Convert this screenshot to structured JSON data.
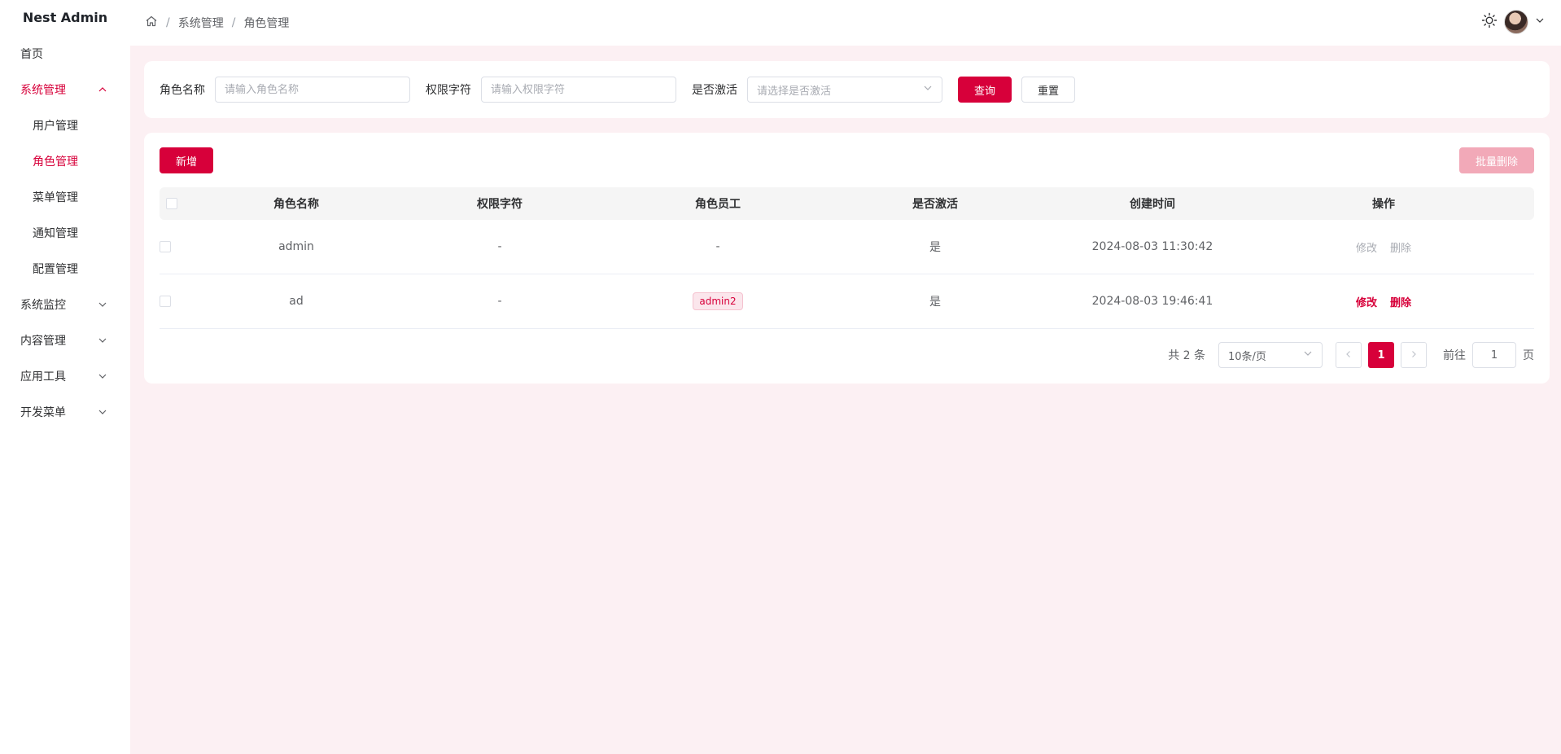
{
  "app": {
    "title": "Nest Admin"
  },
  "sidebar": {
    "items": [
      {
        "label": "首页"
      },
      {
        "label": "系统管理"
      },
      {
        "label": "用户管理"
      },
      {
        "label": "角色管理"
      },
      {
        "label": "菜单管理"
      },
      {
        "label": "通知管理"
      },
      {
        "label": "配置管理"
      },
      {
        "label": "系统监控"
      },
      {
        "label": "内容管理"
      },
      {
        "label": "应用工具"
      },
      {
        "label": "开发菜单"
      }
    ]
  },
  "breadcrumb": {
    "items": [
      "系统管理",
      "角色管理"
    ],
    "separator": "/"
  },
  "search": {
    "role_name_label": "角色名称",
    "role_name_placeholder": "请输入角色名称",
    "perm_label": "权限字符",
    "perm_placeholder": "请输入权限字符",
    "active_label": "是否激活",
    "active_placeholder": "请选择是否激活",
    "query_label": "查询",
    "reset_label": "重置"
  },
  "toolbar": {
    "add_label": "新增",
    "batch_delete_label": "批量删除"
  },
  "table": {
    "headers": [
      "角色名称",
      "权限字符",
      "角色员工",
      "是否激活",
      "创建时间",
      "操作"
    ],
    "rows": [
      {
        "name": "admin",
        "perm": "-",
        "staff": "-",
        "active": "是",
        "created": "2024-08-03 11:30:42",
        "edit": "修改",
        "delete": "删除"
      },
      {
        "name": "ad",
        "perm": "-",
        "staff": "admin2",
        "active": "是",
        "created": "2024-08-03 19:46:41",
        "edit": "修改",
        "delete": "删除"
      }
    ]
  },
  "pagination": {
    "total_text": "共 2 条",
    "page_size": "10条/页",
    "current_page": "1",
    "goto_label": "前往",
    "goto_value": "1",
    "page_suffix": "页"
  },
  "colors": {
    "accent": "#d7003a",
    "background": "#fcf0f3"
  }
}
